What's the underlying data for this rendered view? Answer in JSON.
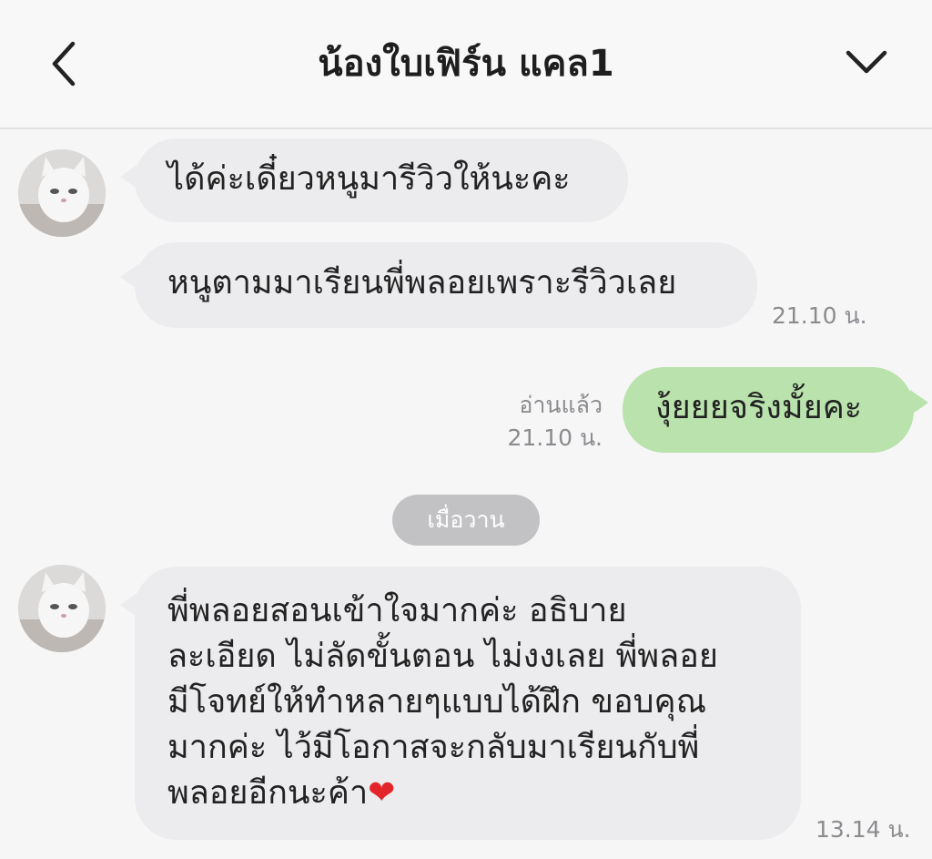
{
  "header": {
    "title": "น้องใบเฟิร์น แคล1"
  },
  "chat": {
    "messages": [
      {
        "text": "ได้ค่ะเดี๋ยวหนูมารีวิวให้นะคะ"
      },
      {
        "text": "หนูตามมาเรียนพี่พลอยเพราะรีวิวเลย",
        "time": "21.10 น."
      },
      {
        "text": "งุ้ยยยจริงมั้ยคะ",
        "read": "อ่านแล้ว",
        "time": "21.10 น."
      },
      {
        "text": "พี่พลอยสอนเข้าใจมากค่ะ อธิบาย\nละเอียด ไม่ลัดขั้นตอน ไม่งงเลย พี่พลอย\nมีโจทย์ให้ทำหลายๆแบบได้ฝึก ขอบคุณ\nมากค่ะ ไว้มีโอกาสจะกลับมาเรียนกับพี่\nพลอยอีกนะค้า",
        "emoji": "❤",
        "time": "13.14 น."
      }
    ],
    "date_separator": "เมื่อวาน"
  },
  "colors": {
    "incoming_bubble": "#ececee",
    "outgoing_bubble": "#b9e2ad",
    "background": "#f6f6f7"
  }
}
